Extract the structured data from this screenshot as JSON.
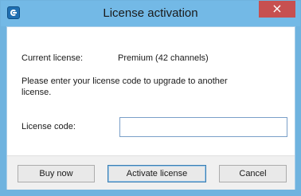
{
  "window": {
    "title": "License activation",
    "close_glyph": "×",
    "icon": "app-icon"
  },
  "current_license": {
    "label": "Current license:",
    "value": "Premium (42 channels)"
  },
  "instructions": "Please enter your license code to upgrade to another license.",
  "license_code": {
    "label": "License code:",
    "value": "",
    "placeholder": ""
  },
  "buttons": {
    "buy_now": "Buy now",
    "activate": "Activate license",
    "cancel": "Cancel"
  },
  "colors": {
    "titlebar": "#73b9e6",
    "close": "#c75050",
    "footer": "#f0f0f0"
  }
}
